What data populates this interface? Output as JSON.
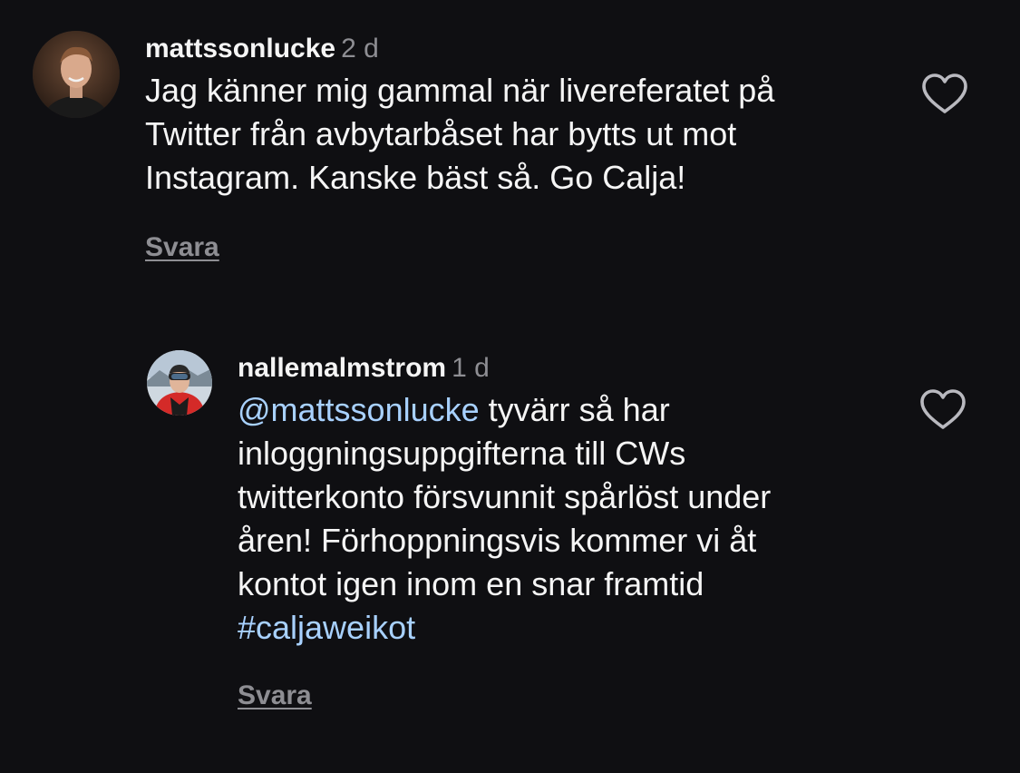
{
  "comments": [
    {
      "username": "mattssonlucke",
      "time": "2 d",
      "text": "Jag känner mig gammal när livereferatet på Twitter från avbytarbåset har bytts ut mot Instagram. Kanske bäst så. Go Calja!",
      "reply_label": "Svara",
      "like_icon": "heart-outline-icon"
    },
    {
      "username": "nallemalmstrom",
      "time": "1 d",
      "mention": "@mattssonlucke",
      "text": " tyvärr så har inloggningsuppgifterna till CWs twitterkonto försvunnit spårlöst under åren! Förhoppningsvis kommer vi åt kontot igen inom en snar framtid ",
      "hashtag": "#caljaweikot",
      "reply_label": "Svara",
      "like_icon": "heart-outline-icon"
    }
  ],
  "colors": {
    "background": "#0f0f12",
    "text": "#f5f5f5",
    "muted": "#8e8e93",
    "link": "#a8d1ff"
  }
}
